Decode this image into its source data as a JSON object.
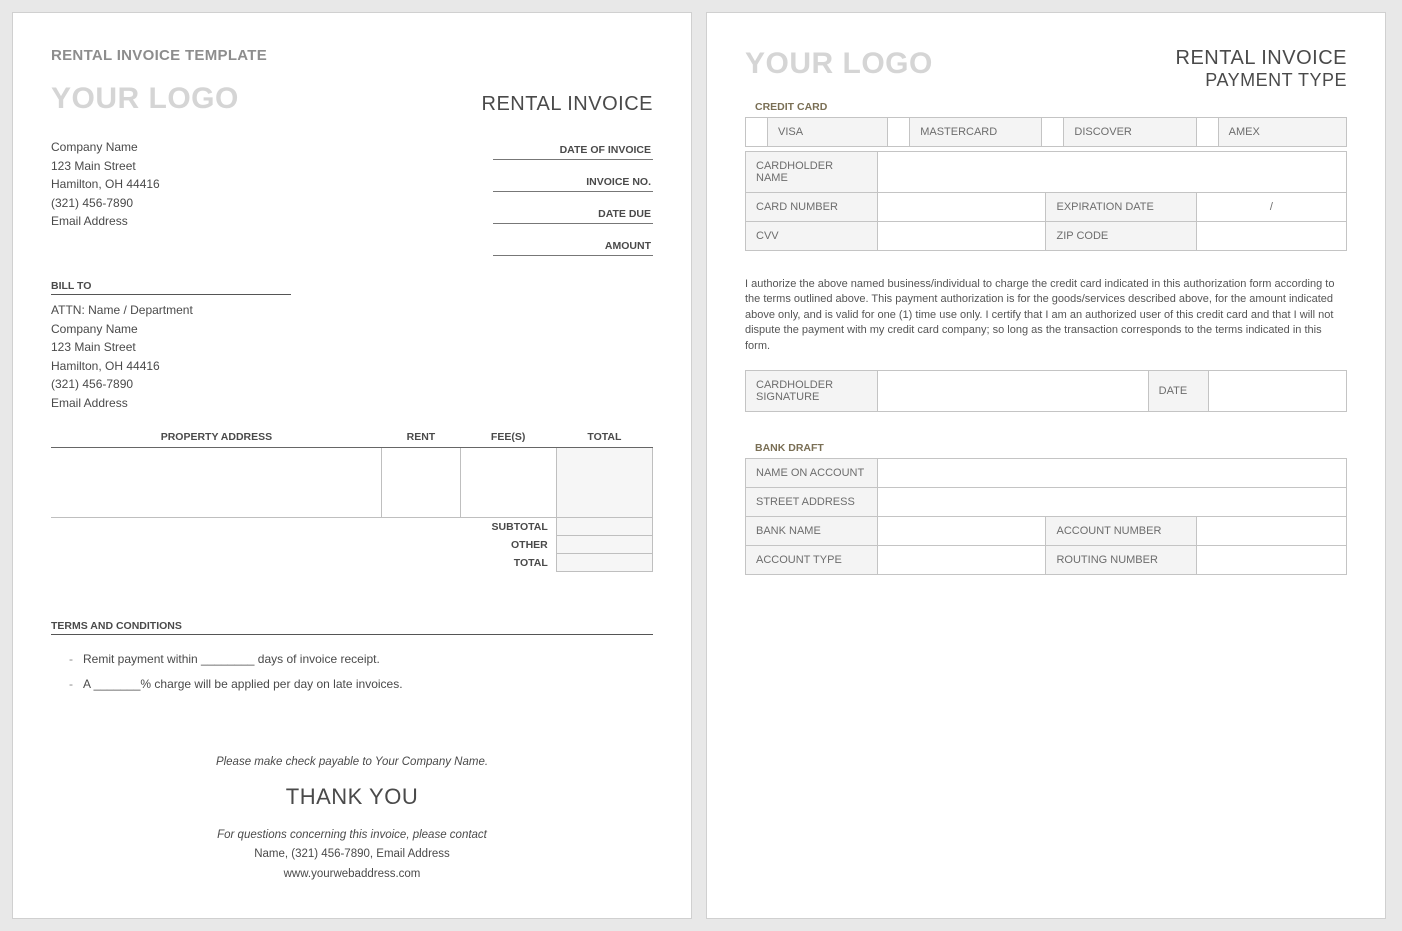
{
  "doc_title": "RENTAL INVOICE TEMPLATE",
  "logo_text": "YOUR LOGO",
  "page1": {
    "heading": "RENTAL INVOICE",
    "company": {
      "name": "Company Name",
      "street": "123 Main Street",
      "city": "Hamilton, OH  44416",
      "phone": "(321) 456-7890",
      "email": "Email Address"
    },
    "meta": {
      "date_of_invoice": "DATE OF INVOICE",
      "invoice_no": "INVOICE NO.",
      "date_due": "DATE DUE",
      "amount": "AMOUNT"
    },
    "bill_to_label": "BILL TO",
    "bill_to": {
      "attn": "ATTN: Name / Department",
      "name": "Company Name",
      "street": "123 Main Street",
      "city": "Hamilton, OH  44416",
      "phone": "(321) 456-7890",
      "email": "Email Address"
    },
    "table_headers": {
      "property": "PROPERTY ADDRESS",
      "rent": "RENT",
      "fees": "FEE(S)",
      "total": "TOTAL"
    },
    "totals": {
      "subtotal": "SUBTOTAL",
      "other": "OTHER",
      "total": "TOTAL"
    },
    "terms_label": "TERMS AND CONDITIONS",
    "terms": [
      "Remit payment within ________ days of invoice receipt.",
      "A _______% charge will be applied per day on late invoices."
    ],
    "footer": {
      "payable": "Please make check payable to Your Company Name.",
      "thank": "THANK YOU",
      "contact_intro": "For questions concerning this invoice, please contact",
      "contact_line": "Name, (321) 456-7890, Email Address",
      "web": "www.yourwebaddress.com"
    }
  },
  "page2": {
    "heading1": "RENTAL INVOICE",
    "heading2": "PAYMENT TYPE",
    "cc_label": "CREDIT CARD",
    "cc_types": {
      "visa": "VISA",
      "mc": "MASTERCARD",
      "disc": "DISCOVER",
      "amex": "AMEX"
    },
    "cc_fields": {
      "cardholder": "CARDHOLDER NAME",
      "cardnumber": "CARD NUMBER",
      "exp": "EXPIRATION DATE",
      "exp_val": "/",
      "cvv": "CVV",
      "zip": "ZIP CODE"
    },
    "auth_text": "I authorize the above named business/individual to charge the credit card indicated in this authorization form according to the terms outlined above. This payment authorization is for the goods/services described above, for the amount indicated above only, and is valid for one (1) time use only. I certify that I am an authorized user of this credit card and that I will not dispute the payment with my credit card company; so long as the transaction corresponds to the terms indicated in this form.",
    "sig": {
      "label": "CARDHOLDER SIGNATURE",
      "date": "DATE"
    },
    "bank_label": "BANK DRAFT",
    "bank_fields": {
      "name": "NAME ON ACCOUNT",
      "street": "STREET ADDRESS",
      "bank": "BANK NAME",
      "acct": "ACCOUNT NUMBER",
      "type": "ACCOUNT TYPE",
      "routing": "ROUTING NUMBER"
    }
  }
}
